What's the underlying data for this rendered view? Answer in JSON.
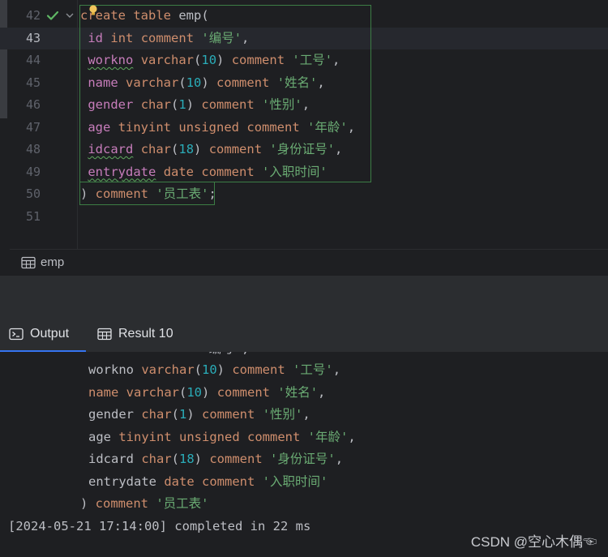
{
  "editor": {
    "lines": [
      {
        "num": "42",
        "tokens": [
          {
            "t": "create",
            "c": "kw"
          },
          {
            "t": " ",
            "c": "pl"
          },
          {
            "t": "table",
            "c": "kw"
          },
          {
            "t": " emp(",
            "c": "pl"
          }
        ]
      },
      {
        "num": "43",
        "tokens": [
          {
            "t": " ",
            "c": "pl"
          },
          {
            "t": "id",
            "c": "id"
          },
          {
            "t": " ",
            "c": "pl"
          },
          {
            "t": "int",
            "c": "ty"
          },
          {
            "t": " ",
            "c": "pl"
          },
          {
            "t": "comment",
            "c": "kw"
          },
          {
            "t": " ",
            "c": "pl"
          },
          {
            "t": "'编号'",
            "c": "str"
          },
          {
            "t": ",",
            "c": "pl"
          }
        ]
      },
      {
        "num": "44",
        "tokens": [
          {
            "t": " ",
            "c": "pl"
          },
          {
            "t": "workno",
            "c": "id wavy"
          },
          {
            "t": " ",
            "c": "pl"
          },
          {
            "t": "varchar",
            "c": "ty"
          },
          {
            "t": "(",
            "c": "pl"
          },
          {
            "t": "10",
            "c": "num"
          },
          {
            "t": ") ",
            "c": "pl"
          },
          {
            "t": "comment",
            "c": "kw"
          },
          {
            "t": " ",
            "c": "pl"
          },
          {
            "t": "'工号'",
            "c": "str"
          },
          {
            "t": ",",
            "c": "pl"
          }
        ]
      },
      {
        "num": "45",
        "tokens": [
          {
            "t": " ",
            "c": "pl"
          },
          {
            "t": "name",
            "c": "id"
          },
          {
            "t": " ",
            "c": "pl"
          },
          {
            "t": "varchar",
            "c": "ty"
          },
          {
            "t": "(",
            "c": "pl"
          },
          {
            "t": "10",
            "c": "num"
          },
          {
            "t": ") ",
            "c": "pl"
          },
          {
            "t": "comment",
            "c": "kw"
          },
          {
            "t": " ",
            "c": "pl"
          },
          {
            "t": "'姓名'",
            "c": "str"
          },
          {
            "t": ",",
            "c": "pl"
          }
        ]
      },
      {
        "num": "46",
        "tokens": [
          {
            "t": " ",
            "c": "pl"
          },
          {
            "t": "gender",
            "c": "id"
          },
          {
            "t": " ",
            "c": "pl"
          },
          {
            "t": "char",
            "c": "ty"
          },
          {
            "t": "(",
            "c": "pl"
          },
          {
            "t": "1",
            "c": "num"
          },
          {
            "t": ") ",
            "c": "pl"
          },
          {
            "t": "comment",
            "c": "kw"
          },
          {
            "t": " ",
            "c": "pl"
          },
          {
            "t": "'性别'",
            "c": "str"
          },
          {
            "t": ",",
            "c": "pl"
          }
        ]
      },
      {
        "num": "47",
        "tokens": [
          {
            "t": " ",
            "c": "pl"
          },
          {
            "t": "age",
            "c": "id"
          },
          {
            "t": " ",
            "c": "pl"
          },
          {
            "t": "tinyint",
            "c": "ty"
          },
          {
            "t": " ",
            "c": "pl"
          },
          {
            "t": "unsigned",
            "c": "kw"
          },
          {
            "t": " ",
            "c": "pl"
          },
          {
            "t": "comment",
            "c": "kw"
          },
          {
            "t": " ",
            "c": "pl"
          },
          {
            "t": "'年龄'",
            "c": "str"
          },
          {
            "t": ",",
            "c": "pl"
          }
        ]
      },
      {
        "num": "48",
        "tokens": [
          {
            "t": " ",
            "c": "pl"
          },
          {
            "t": "idcard",
            "c": "id wavy"
          },
          {
            "t": " ",
            "c": "pl"
          },
          {
            "t": "char",
            "c": "ty"
          },
          {
            "t": "(",
            "c": "pl"
          },
          {
            "t": "18",
            "c": "num"
          },
          {
            "t": ") ",
            "c": "pl"
          },
          {
            "t": "comment",
            "c": "kw"
          },
          {
            "t": " ",
            "c": "pl"
          },
          {
            "t": "'身份证号'",
            "c": "str"
          },
          {
            "t": ",",
            "c": "pl"
          }
        ]
      },
      {
        "num": "49",
        "tokens": [
          {
            "t": " ",
            "c": "pl"
          },
          {
            "t": "entrydate",
            "c": "id wavy"
          },
          {
            "t": " ",
            "c": "pl"
          },
          {
            "t": "date",
            "c": "ty"
          },
          {
            "t": " ",
            "c": "pl"
          },
          {
            "t": "comment",
            "c": "kw"
          },
          {
            "t": " ",
            "c": "pl"
          },
          {
            "t": "'入职时间'",
            "c": "str"
          }
        ]
      },
      {
        "num": "50",
        "tokens": [
          {
            "t": ") ",
            "c": "pl"
          },
          {
            "t": "comment",
            "c": "kw"
          },
          {
            "t": " ",
            "c": "pl"
          },
          {
            "t": "'员工表'",
            "c": "str"
          },
          {
            "t": ";",
            "c": "pl"
          }
        ]
      },
      {
        "num": "51",
        "tokens": []
      }
    ],
    "current_line": "43",
    "tab_label": "emp"
  },
  "output_tabs": {
    "output_label": "Output",
    "result_label": "Result 10"
  },
  "output": {
    "clipped_line": "                 编号',",
    "lines": [
      {
        "tokens": [
          {
            "t": "workno ",
            "c": "pl"
          },
          {
            "t": "varchar",
            "c": "ty"
          },
          {
            "t": "(",
            "c": "pl"
          },
          {
            "t": "10",
            "c": "num"
          },
          {
            "t": ") ",
            "c": "pl"
          },
          {
            "t": "comment",
            "c": "kw"
          },
          {
            "t": " ",
            "c": "pl"
          },
          {
            "t": "'工号'",
            "c": "str"
          },
          {
            "t": ",",
            "c": "pl"
          }
        ]
      },
      {
        "tokens": [
          {
            "t": "name",
            "c": "kw"
          },
          {
            "t": " ",
            "c": "pl"
          },
          {
            "t": "varchar",
            "c": "ty"
          },
          {
            "t": "(",
            "c": "pl"
          },
          {
            "t": "10",
            "c": "num"
          },
          {
            "t": ") ",
            "c": "pl"
          },
          {
            "t": "comment",
            "c": "kw"
          },
          {
            "t": " ",
            "c": "pl"
          },
          {
            "t": "'姓名'",
            "c": "str"
          },
          {
            "t": ",",
            "c": "pl"
          }
        ]
      },
      {
        "tokens": [
          {
            "t": "gender ",
            "c": "pl"
          },
          {
            "t": "char",
            "c": "ty"
          },
          {
            "t": "(",
            "c": "pl"
          },
          {
            "t": "1",
            "c": "num"
          },
          {
            "t": ") ",
            "c": "pl"
          },
          {
            "t": "comment",
            "c": "kw"
          },
          {
            "t": " ",
            "c": "pl"
          },
          {
            "t": "'性别'",
            "c": "str"
          },
          {
            "t": ",",
            "c": "pl"
          }
        ]
      },
      {
        "tokens": [
          {
            "t": "age ",
            "c": "pl"
          },
          {
            "t": "tinyint",
            "c": "ty"
          },
          {
            "t": " ",
            "c": "pl"
          },
          {
            "t": "unsigned",
            "c": "kw"
          },
          {
            "t": " ",
            "c": "pl"
          },
          {
            "t": "comment",
            "c": "kw"
          },
          {
            "t": " ",
            "c": "pl"
          },
          {
            "t": "'年龄'",
            "c": "str"
          },
          {
            "t": ",",
            "c": "pl"
          }
        ]
      },
      {
        "tokens": [
          {
            "t": "idcard ",
            "c": "pl"
          },
          {
            "t": "char",
            "c": "ty"
          },
          {
            "t": "(",
            "c": "pl"
          },
          {
            "t": "18",
            "c": "num"
          },
          {
            "t": ") ",
            "c": "pl"
          },
          {
            "t": "comment",
            "c": "kw"
          },
          {
            "t": " ",
            "c": "pl"
          },
          {
            "t": "'身份证号'",
            "c": "str"
          },
          {
            "t": ",",
            "c": "pl"
          }
        ]
      },
      {
        "tokens": [
          {
            "t": "entrydate ",
            "c": "pl"
          },
          {
            "t": "date",
            "c": "ty"
          },
          {
            "t": " ",
            "c": "pl"
          },
          {
            "t": "comment",
            "c": "kw"
          },
          {
            "t": " ",
            "c": "pl"
          },
          {
            "t": "'入职时间'",
            "c": "str"
          }
        ]
      },
      {
        "tokens": [
          {
            "t": ") ",
            "c": "pl"
          },
          {
            "t": "comment",
            "c": "kw"
          },
          {
            "t": " ",
            "c": "pl"
          },
          {
            "t": "'员工表'",
            "c": "str"
          }
        ]
      }
    ],
    "status": "[2024-05-21 17:14:00] completed in 22 ms"
  },
  "watermark": "CSDN @空心木偶☜",
  "colors": {
    "keyword": "#cf8e6d",
    "identifier": "#c77dbb",
    "number": "#2aacb8",
    "string": "#6aab73",
    "accent": "#3574f0",
    "check": "#5fb865"
  }
}
